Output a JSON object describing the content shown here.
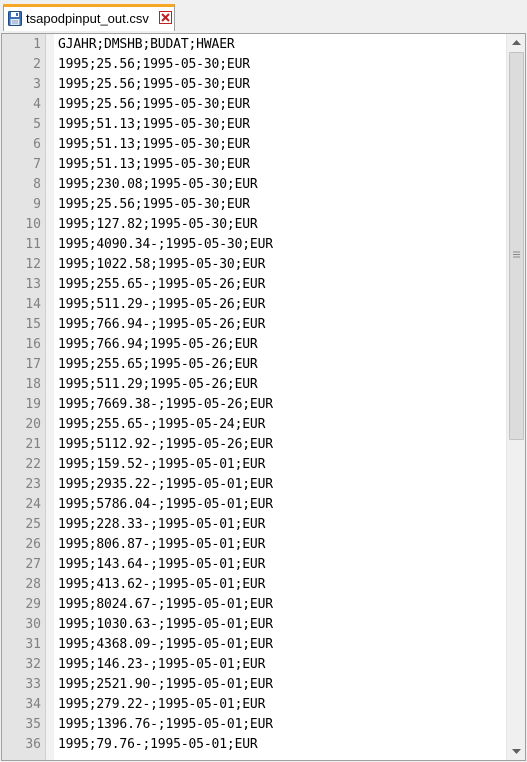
{
  "tab": {
    "filename": "tsapodpinput_out.csv",
    "file_icon": "floppy-disk-icon",
    "close_icon": "close-icon",
    "accent_color": "#f5a623",
    "close_color": "#c02020"
  },
  "scrollbar": {
    "up_icon": "arrow-up-icon",
    "down_icon": "arrow-down-icon",
    "grip_icon": "grip-icon"
  },
  "lines": [
    {
      "number": "1",
      "text": "GJAHR;DMSHB;BUDAT;HWAER"
    },
    {
      "number": "2",
      "text": "1995;25.56;1995-05-30;EUR"
    },
    {
      "number": "3",
      "text": "1995;25.56;1995-05-30;EUR"
    },
    {
      "number": "4",
      "text": "1995;25.56;1995-05-30;EUR"
    },
    {
      "number": "5",
      "text": "1995;51.13;1995-05-30;EUR"
    },
    {
      "number": "6",
      "text": "1995;51.13;1995-05-30;EUR"
    },
    {
      "number": "7",
      "text": "1995;51.13;1995-05-30;EUR"
    },
    {
      "number": "8",
      "text": "1995;230.08;1995-05-30;EUR"
    },
    {
      "number": "9",
      "text": "1995;25.56;1995-05-30;EUR"
    },
    {
      "number": "10",
      "text": "1995;127.82;1995-05-30;EUR"
    },
    {
      "number": "11",
      "text": "1995;4090.34-;1995-05-30;EUR"
    },
    {
      "number": "12",
      "text": "1995;1022.58;1995-05-30;EUR"
    },
    {
      "number": "13",
      "text": "1995;255.65-;1995-05-26;EUR"
    },
    {
      "number": "14",
      "text": "1995;511.29-;1995-05-26;EUR"
    },
    {
      "number": "15",
      "text": "1995;766.94-;1995-05-26;EUR"
    },
    {
      "number": "16",
      "text": "1995;766.94;1995-05-26;EUR"
    },
    {
      "number": "17",
      "text": "1995;255.65;1995-05-26;EUR"
    },
    {
      "number": "18",
      "text": "1995;511.29;1995-05-26;EUR"
    },
    {
      "number": "19",
      "text": "1995;7669.38-;1995-05-26;EUR"
    },
    {
      "number": "20",
      "text": "1995;255.65-;1995-05-24;EUR"
    },
    {
      "number": "21",
      "text": "1995;5112.92-;1995-05-26;EUR"
    },
    {
      "number": "22",
      "text": "1995;159.52-;1995-05-01;EUR"
    },
    {
      "number": "23",
      "text": "1995;2935.22-;1995-05-01;EUR"
    },
    {
      "number": "24",
      "text": "1995;5786.04-;1995-05-01;EUR"
    },
    {
      "number": "25",
      "text": "1995;228.33-;1995-05-01;EUR"
    },
    {
      "number": "26",
      "text": "1995;806.87-;1995-05-01;EUR"
    },
    {
      "number": "27",
      "text": "1995;143.64-;1995-05-01;EUR"
    },
    {
      "number": "28",
      "text": "1995;413.62-;1995-05-01;EUR"
    },
    {
      "number": "29",
      "text": "1995;8024.67-;1995-05-01;EUR"
    },
    {
      "number": "30",
      "text": "1995;1030.63-;1995-05-01;EUR"
    },
    {
      "number": "31",
      "text": "1995;4368.09-;1995-05-01;EUR"
    },
    {
      "number": "32",
      "text": "1995;146.23-;1995-05-01;EUR"
    },
    {
      "number": "33",
      "text": "1995;2521.90-;1995-05-01;EUR"
    },
    {
      "number": "34",
      "text": "1995;279.22-;1995-05-01;EUR"
    },
    {
      "number": "35",
      "text": "1995;1396.76-;1995-05-01;EUR"
    },
    {
      "number": "36",
      "text": "1995;79.76-;1995-05-01;EUR"
    }
  ]
}
